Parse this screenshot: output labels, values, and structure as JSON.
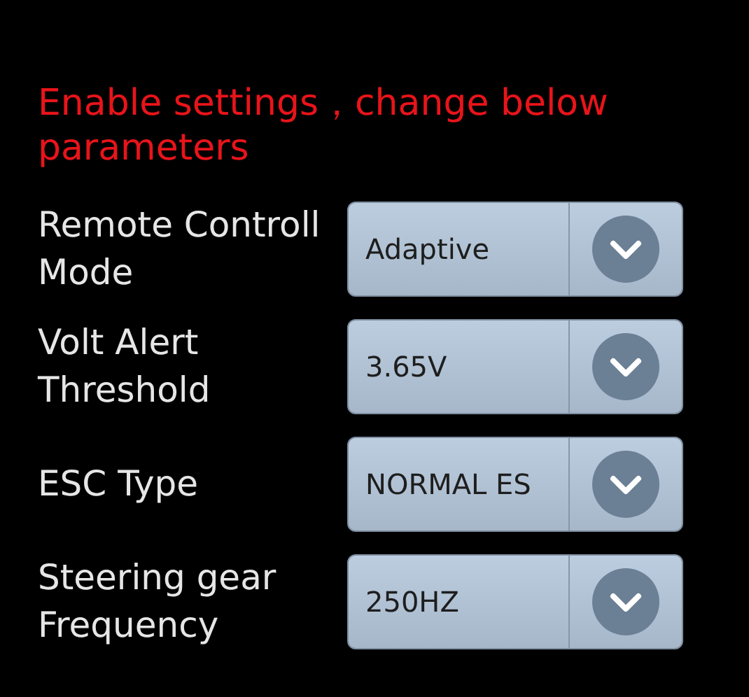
{
  "header": "Enable settings，change below parameters",
  "settings": [
    {
      "label": "Remote Controll Mode",
      "value": "Adaptive"
    },
    {
      "label": "Volt Alert Threshold",
      "value": "3.65V"
    },
    {
      "label": "ESC Type",
      "value": "NORMAL ES"
    },
    {
      "label": "Steering gear Frequency",
      "value": "250HZ"
    }
  ]
}
